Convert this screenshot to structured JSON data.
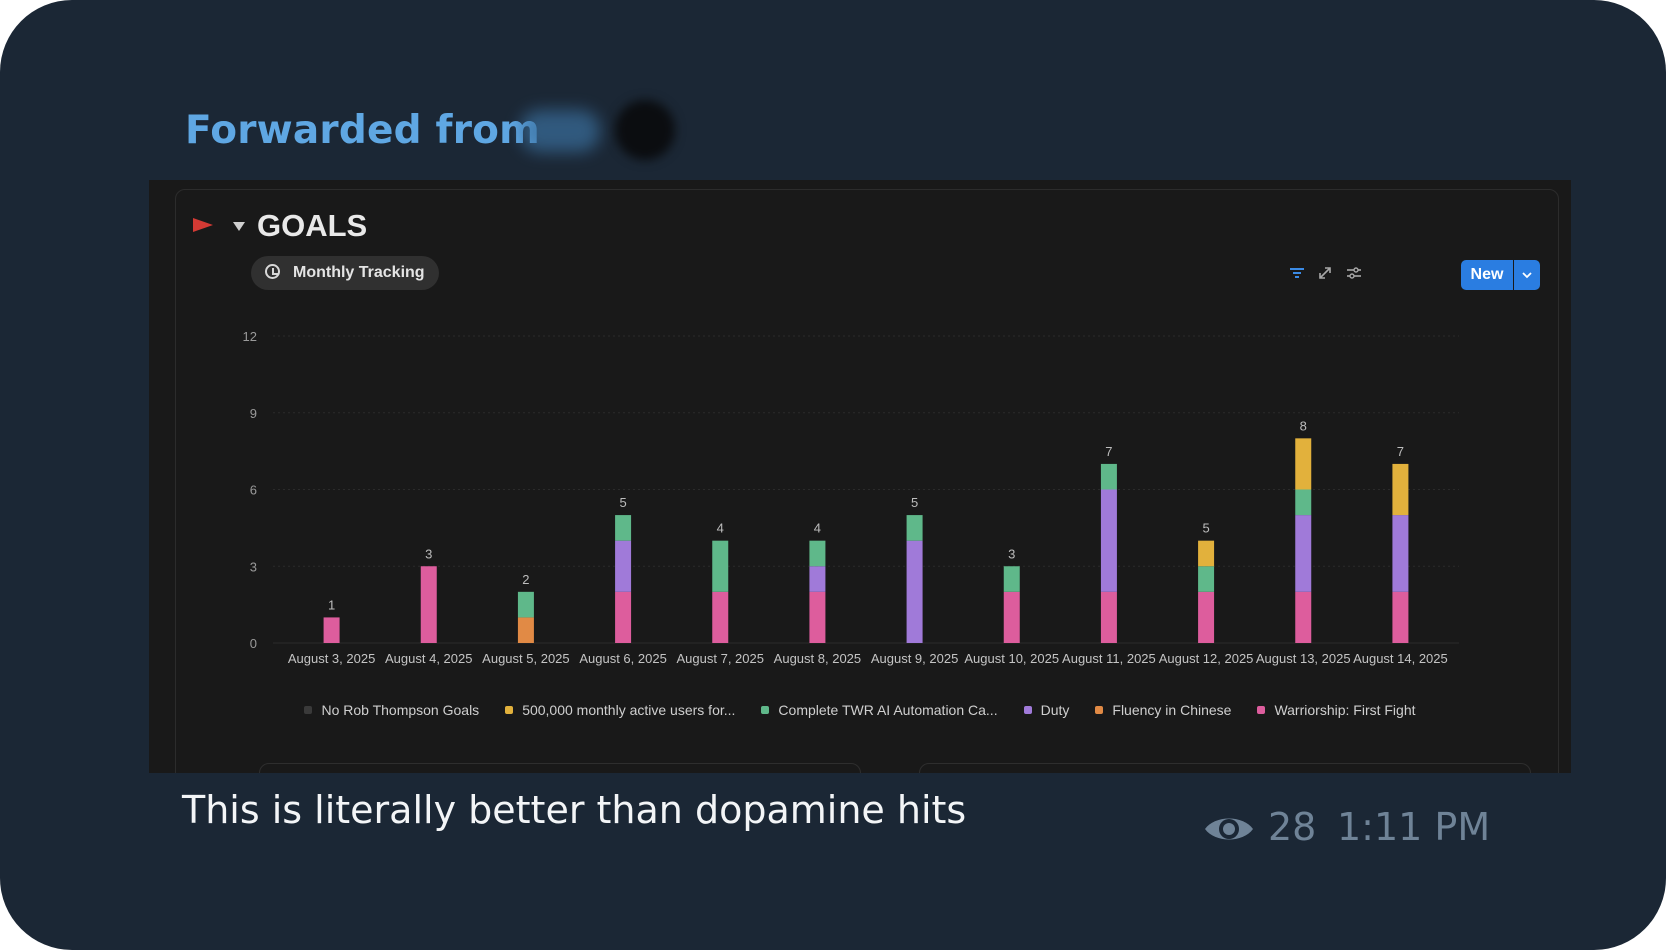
{
  "message": {
    "forwarded_label": "Forwarded from",
    "caption": "This is literally better than dopamine hits",
    "views": "28",
    "time": "1:11 PM"
  },
  "goals": {
    "title": "GOALS",
    "tab_label": "Monthly Tracking",
    "new_button_label": "New",
    "colors": {
      "accent": "#2a7de1",
      "flag": "#d33a34"
    }
  },
  "chart_data": {
    "type": "bar",
    "stacked": true,
    "ylim": [
      0,
      12
    ],
    "yticks": [
      0,
      3,
      6,
      9,
      12
    ],
    "grid": true,
    "legend_position": "bottom",
    "categories": [
      "August 3, 2025",
      "August 4, 2025",
      "August 5, 2025",
      "August 6, 2025",
      "August 7, 2025",
      "August 8, 2025",
      "August 9, 2025",
      "August 10, 2025",
      "August 11, 2025",
      "August 12, 2025",
      "August 13, 2025",
      "August 14, 2025"
    ],
    "totals": [
      1,
      3,
      2,
      5,
      4,
      4,
      5,
      3,
      7,
      5,
      8,
      7
    ],
    "series": [
      {
        "name": "No Rob Thompson Goals",
        "color": "#3a3a3a",
        "values": [
          0,
          0,
          0,
          0,
          0,
          0,
          0,
          0,
          0,
          0,
          0,
          0
        ]
      },
      {
        "name": "500,000 monthly active users for...",
        "color": "#e2b13c",
        "values": [
          0,
          0,
          0,
          0,
          0,
          0,
          0,
          0,
          0,
          1,
          2,
          2
        ]
      },
      {
        "name": "Complete TWR AI Automation Ca...",
        "color": "#5fb88a",
        "values": [
          0,
          0,
          1,
          1,
          2,
          1,
          1,
          1,
          1,
          1,
          1,
          0
        ]
      },
      {
        "name": "Duty",
        "color": "#a07ad9",
        "values": [
          0,
          0,
          0,
          2,
          0,
          1,
          4,
          0,
          4,
          0,
          3,
          3
        ]
      },
      {
        "name": "Fluency in Chinese",
        "color": "#e18a45",
        "values": [
          0,
          0,
          1,
          0,
          0,
          0,
          0,
          0,
          0,
          0,
          0,
          0
        ]
      },
      {
        "name": "Warriorship: First Fight",
        "color": "#dd5d9d",
        "values": [
          1,
          3,
          0,
          2,
          2,
          2,
          0,
          2,
          2,
          2,
          2,
          2
        ]
      }
    ]
  }
}
